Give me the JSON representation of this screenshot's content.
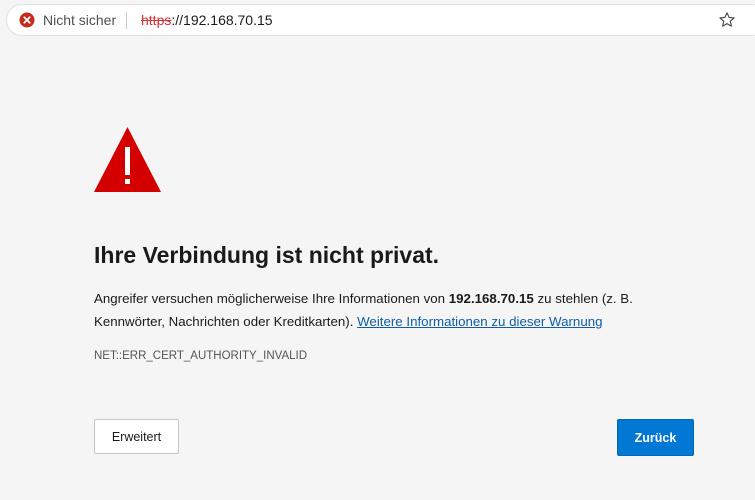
{
  "addressbar": {
    "security_label": "Nicht sicher",
    "url_scheme": "https",
    "url_rest": "://192.168.70.15",
    "security_icon": "error-circle-icon",
    "favorite_icon": "star-icon",
    "error_color": "#d13438"
  },
  "interstitial": {
    "warning_icon": "warning-triangle-icon",
    "warning_color": "#d40000",
    "title": "Ihre Verbindung ist nicht privat.",
    "body_prefix": "Angreifer versuchen möglicherweise Ihre Informationen von ",
    "host": "192.168.70.15",
    "body_suffix": " zu stehlen (z. B. Kennwörter, Nachrichten oder Kreditkarten). ",
    "link_text": "Weitere Informationen zu dieser Warnung",
    "error_code": "NET::ERR_CERT_AUTHORITY_INVALID",
    "advanced_button": "Erweitert",
    "back_button": "Zurück",
    "accent_color": "#0078d4",
    "link_color": "#0f5da7"
  }
}
